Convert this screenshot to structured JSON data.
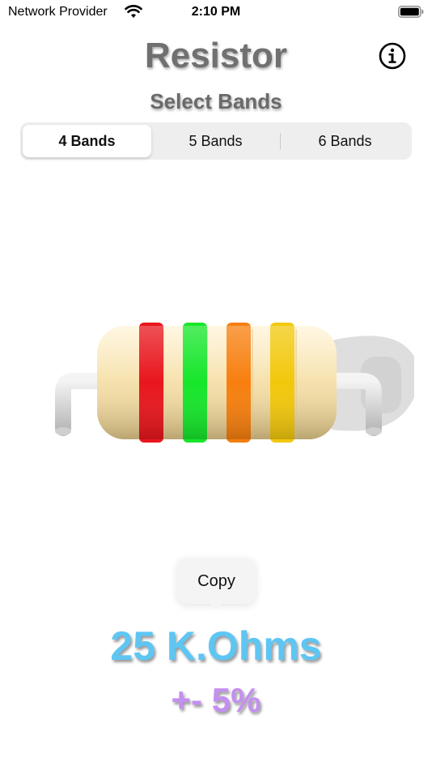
{
  "status_bar": {
    "carrier": "Network Provider",
    "time": "2:10 PM",
    "wifi_icon": "wifi-icon",
    "battery_icon": "battery-icon"
  },
  "header": {
    "title": "Resistor",
    "subtitle": "Select Bands",
    "info_icon": "info-icon"
  },
  "band_selector": {
    "options": [
      "4 Bands",
      "5 Bands",
      "6 Bands"
    ],
    "selected": "4 Bands"
  },
  "resistor": {
    "body_color": "#f7e3b0",
    "bands": [
      {
        "color_name": "red",
        "color": "#e8161c"
      },
      {
        "color_name": "green",
        "color": "#16e62a"
      },
      {
        "color_name": "orange",
        "color": "#f77f0e"
      },
      {
        "color_name": "gold",
        "color": "#f2c80c"
      }
    ]
  },
  "copy_menu": {
    "label": "Copy"
  },
  "result": {
    "resistance": "25 K.Ohms",
    "tolerance": "+- 5%",
    "resistance_color": "#5ec6f3",
    "tolerance_color": "#c48ff0"
  }
}
